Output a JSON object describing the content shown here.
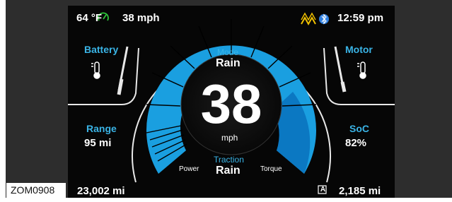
{
  "status_bar": {
    "temperature": "64 °F",
    "speed": "38 mph",
    "time": "12:59 pm"
  },
  "left_panel": {
    "battery_label": "Battery",
    "range_label": "Range",
    "range_value": "95 mi",
    "odometer": "23,002 mi"
  },
  "right_panel": {
    "motor_label": "Motor",
    "soc_label": "SoC",
    "soc_value": "82%",
    "trip_label": "A",
    "trip_value": "2,185 mi"
  },
  "gauge": {
    "mode_label": "Mode",
    "mode_value": "Rain",
    "speed_value": "38",
    "speed_unit": "mph",
    "traction_label": "Traction",
    "traction_value": "Rain",
    "power_label": "Power",
    "torque_label": "Torque"
  },
  "colors": {
    "accent": "#3ab4e6",
    "gauge_fill": "#1a9fe0",
    "gauge_dark": "#0b6fb2",
    "warning": "#f2c200",
    "eco_green": "#2ec23a",
    "bluetooth": "#2f7fe0"
  },
  "icons": {
    "speed_limit": "eco-gauge-icon",
    "battery_temp": "thermometer-icon",
    "motor_temp": "thermometer-icon",
    "traction_warning": "wheel-slip-icon",
    "bluetooth": "bluetooth-icon"
  },
  "figure_label": "ZOM0908"
}
